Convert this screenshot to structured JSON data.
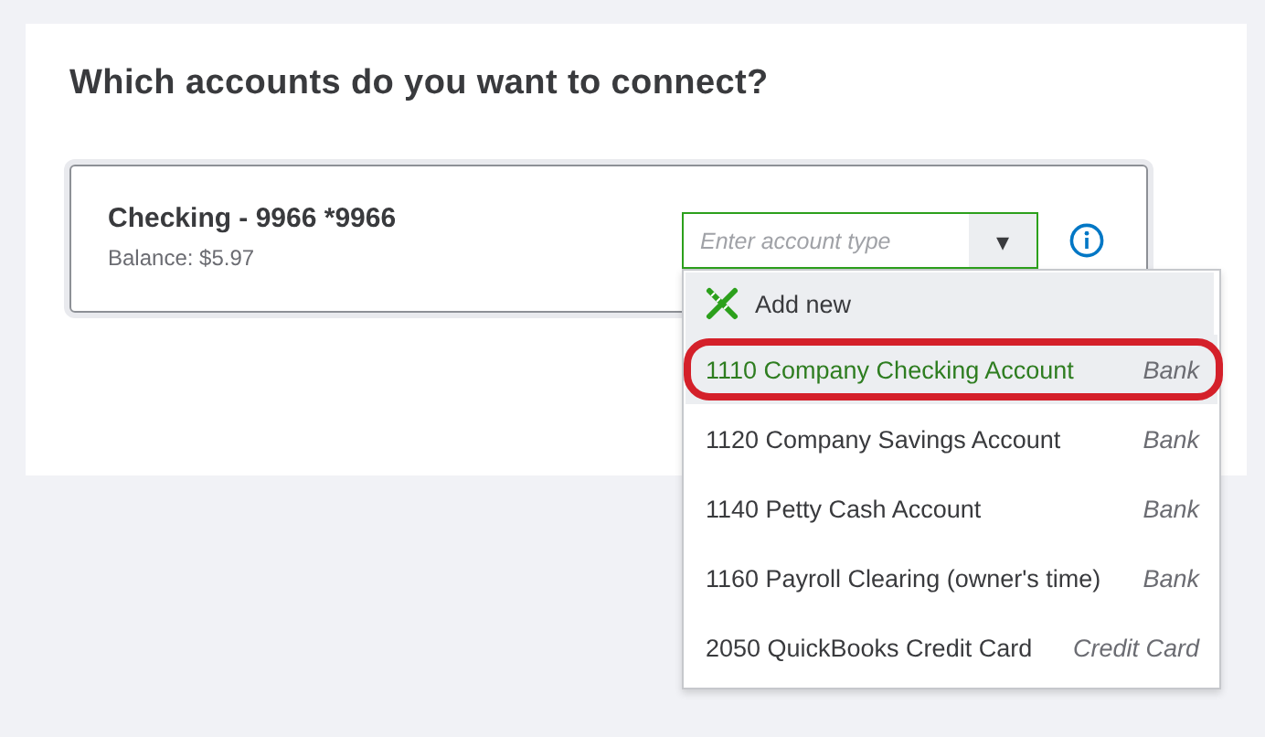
{
  "title": "Which accounts do you want to connect?",
  "account": {
    "name": "Checking - 9966 *9966",
    "balance": "Balance: $5.97"
  },
  "account_type_field": {
    "placeholder": "Enter account type",
    "caret": "▾"
  },
  "dropdown": {
    "add_new": "Add new",
    "items": [
      {
        "name": "1110 Company Checking Account",
        "type": "Bank",
        "selected": true,
        "circled": true
      },
      {
        "name": "1120 Company Savings Account",
        "type": "Bank",
        "selected": false,
        "circled": false
      },
      {
        "name": "1140 Petty Cash Account",
        "type": "Bank",
        "selected": false,
        "circled": false
      },
      {
        "name": "1160 Payroll Clearing (owner's time)",
        "type": "Bank",
        "selected": false,
        "circled": false
      },
      {
        "name": "2050 QuickBooks Credit Card",
        "type": "Credit Card",
        "selected": false,
        "circled": false
      }
    ]
  }
}
